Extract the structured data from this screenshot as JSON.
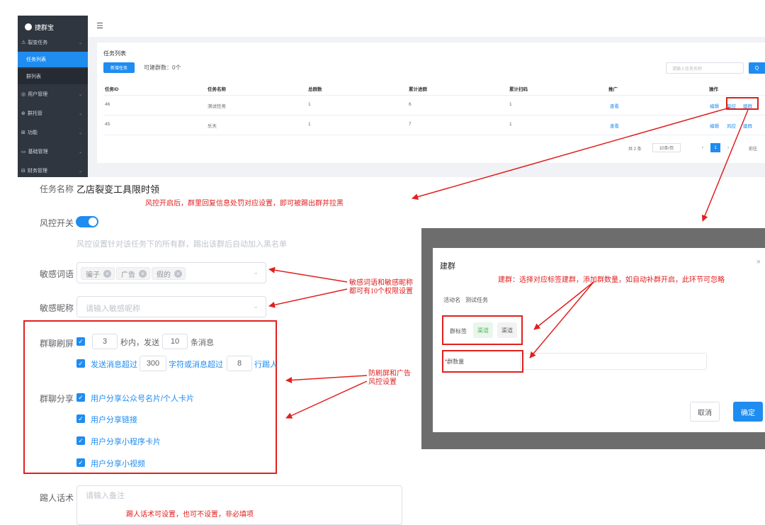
{
  "admin": {
    "brand": "捷群宝",
    "menu_toggle_glyph": "☰",
    "sidebar": [
      {
        "label": "裂变任务",
        "icon": "⚠",
        "chevron": "⌄"
      },
      {
        "label": "任务列表",
        "active": true
      },
      {
        "label": "群列表"
      },
      {
        "label": "用户管理",
        "icon": "◎",
        "chevron": "⌄"
      },
      {
        "label": "群托管",
        "icon": "⊛",
        "chevron": "⌄"
      },
      {
        "label": "功能",
        "icon": "⊞",
        "chevron": "⌄"
      },
      {
        "label": "基础管理",
        "icon": "▭",
        "chevron": "⌄"
      },
      {
        "label": "财务管理",
        "icon": "⊟",
        "chevron": "⌄"
      }
    ],
    "card_title": "任务列表",
    "new_button": "新增任务",
    "available_groups": "可建群数：0个",
    "search_placeholder": "请输入任务名称",
    "search_button": "Q",
    "columns": [
      "任务ID",
      "任务名称",
      "总群数",
      "累计进群",
      "累计扫码",
      "推广",
      "操作"
    ],
    "rows": [
      {
        "id": "46",
        "name": "测试任务",
        "groups": "1",
        "joined": "6",
        "scanned": "1",
        "promo": "查看",
        "actions": [
          "编辑",
          "风控",
          "建群"
        ]
      },
      {
        "id": "45",
        "name": "乐天",
        "groups": "1",
        "joined": "7",
        "scanned": "1",
        "promo": "查看",
        "actions": [
          "编辑",
          "风控",
          "建群"
        ]
      }
    ],
    "pagination": {
      "total": "共 2 条",
      "page_size": "10条/页",
      "prev": "‹",
      "current": "1",
      "next": "›",
      "goto": "前往"
    }
  },
  "form": {
    "task_name_label": "任务名称",
    "task_name_value": "乙店裂变工具限时领",
    "note_risk": "风控开启后，群里回复信息处罚对应设置，即可被踢出群并拉黑",
    "risk_switch_label": "风控开关",
    "risk_switch_on": true,
    "risk_hint": "风控设置针对该任务下的所有群，踢出该群后自动加入黑名单",
    "sensitive_words_label": "敏感词语",
    "sensitive_words": [
      "骗子",
      "广告",
      "假的"
    ],
    "chip_remove_glyph": "×",
    "select_chevron": "⌄",
    "sensitive_nick_label": "敏感昵称",
    "sensitive_nick_placeholder": "请输入敏感昵称",
    "note_sensitive": "敏感词语和敏感昵称\n都可有10个权限设置",
    "spam_label": "群聊刷屏",
    "spam_prefix": "",
    "spam_seconds": "3",
    "spam_mid": "秒内，发送",
    "spam_count": "10",
    "spam_suffix": "条消息",
    "long_msg_prefix": "发送消息超过",
    "long_msg_chars": "300",
    "long_msg_mid": "字符或消息超过",
    "long_msg_lines": "8",
    "long_msg_suffix": "行踢人",
    "share_label": "群聊分享",
    "share_options": [
      "用户分享公众号名片/个人卡片",
      "用户分享链接",
      "用户分享小程序卡片",
      "用户分享小视频"
    ],
    "checkbox_glyph": "✓",
    "note_antispam": "防刷屏和广告\n风控设置",
    "kick_label": "踢人话术",
    "kick_placeholder": "请输入备注",
    "note_kick": "踢人话术可设置，也可不设置，非必填项"
  },
  "modal": {
    "title": "建群",
    "close": "×",
    "note": "建群：选择对应标签建群，添加群数量，如自动补群开启，此环节可忽略",
    "activity_label": "活动名",
    "activity_value": "测试任务",
    "tag_label": "群标签",
    "tags": [
      "渠道",
      "渠道"
    ],
    "count_label": "群数量",
    "required_mark": "*",
    "cancel": "取消",
    "confirm": "确定"
  },
  "colors": {
    "accent": "#1f8cf0",
    "annotation": "#e0201e",
    "sidebar": "#2f3640"
  }
}
